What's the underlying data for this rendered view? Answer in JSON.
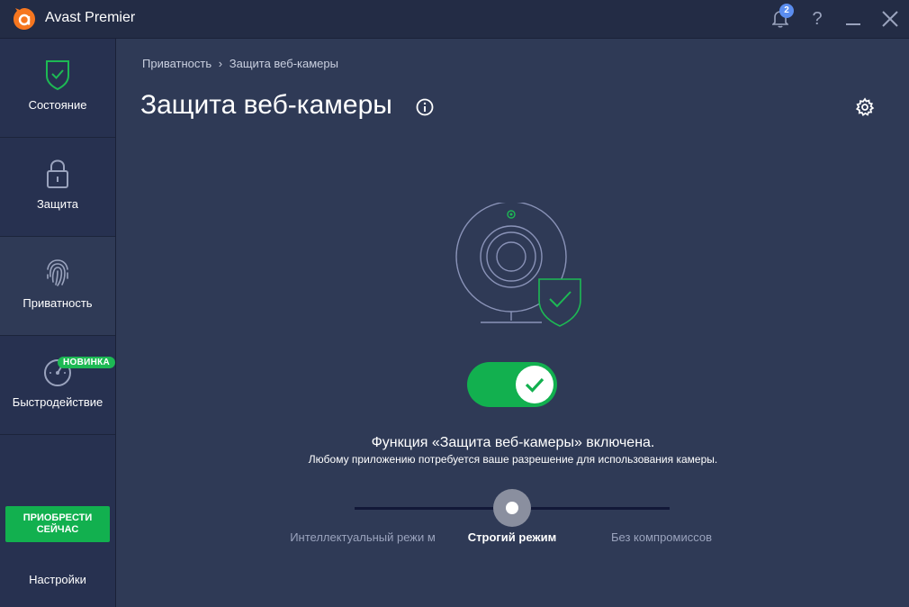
{
  "app": {
    "title": "Avast Premier",
    "notification_count": "2"
  },
  "sidebar": {
    "items": [
      {
        "label": "Состояние",
        "icon": "shield-check-icon"
      },
      {
        "label": "Защита",
        "icon": "lock-icon"
      },
      {
        "label": "Приватность",
        "icon": "fingerprint-icon"
      },
      {
        "label": "Быстродействие",
        "icon": "speedometer-icon",
        "badge": "НОВИНКА"
      }
    ],
    "buy_button": "ПРИОБРЕСТИ СЕЙЧАС",
    "settings": "Настройки"
  },
  "breadcrumb": {
    "parent": "Приватность",
    "separator": "›",
    "current": "Защита веб-камеры"
  },
  "page": {
    "title": "Защита веб-камеры"
  },
  "status": {
    "enabled": true,
    "title": "Функция «Защита веб-камеры» включена.",
    "description": "Любому приложению потребуется ваше разрешение для использования камеры."
  },
  "modes": {
    "options": [
      "Интеллектуальный режи м",
      "Строгий режим",
      "Без компромиссов"
    ],
    "selected": "Строгий режим"
  },
  "colors": {
    "accent_green": "#12b04f",
    "background": "#2f3a56",
    "sidebar": "#273150",
    "orange_logo": "#f6761f"
  }
}
